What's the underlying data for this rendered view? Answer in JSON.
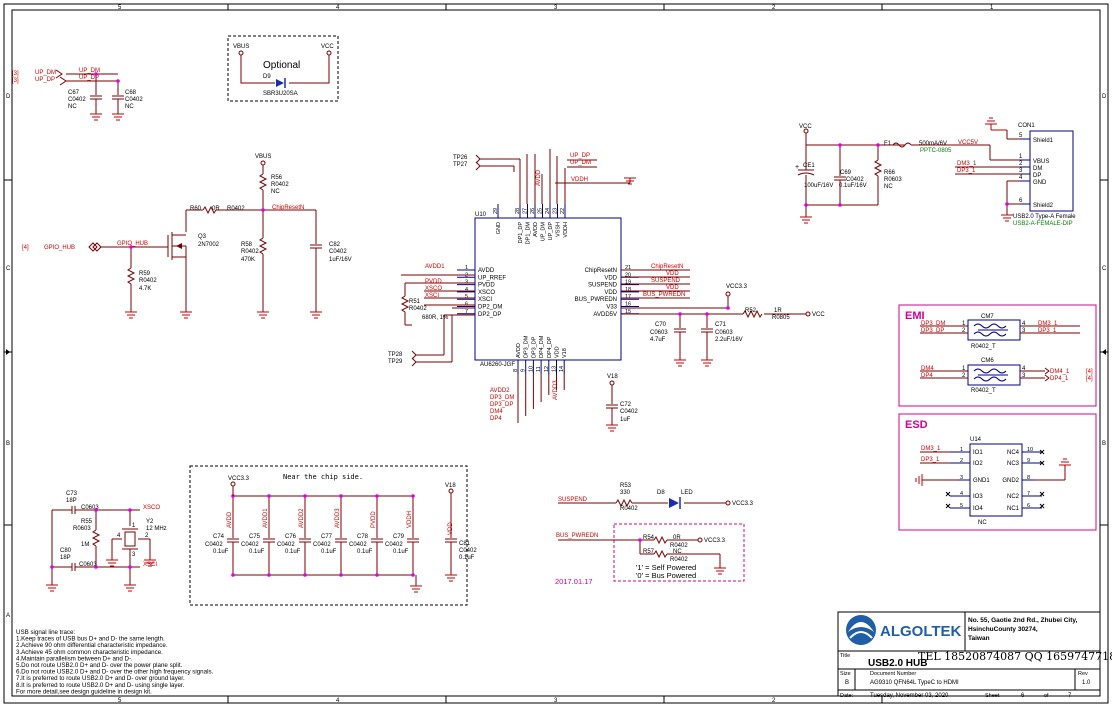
{
  "frame": {
    "cols": [
      "5",
      "4",
      "3",
      "2",
      "1"
    ],
    "rows": [
      "D",
      "C",
      "B",
      "A"
    ]
  },
  "notes": {
    "optional": "Optional",
    "near_chip": "Near the chip side.",
    "date": "2017.01.17",
    "self_powered": "'1' = Self Powered",
    "bus_powered": "'0' = Bus Powered",
    "usb_trace": [
      "USB signal line trace:",
      "1.Keep traces of USB bus D+ and D- the same length.",
      "2.Achieve 90 ohm differential characteristic impedance.",
      "3.Achieve 45 ohm common characteristic impedance.",
      "4.Maintain parallelism between D+ and D-.",
      "5.Do not route USB2.0 D+ and D- over the power plane split.",
      "6.Do not route USB2.0 D+ and D- over the other  high frequency signals.",
      "7.It is preferred to route USB2.0 D+ and D- over ground layer.",
      "8.It is preferred to route USB2.0 D+ and D- using single layer.",
      "For more detail,see design guideline in design kit."
    ]
  },
  "nets": {
    "up_dm": "UP_DM",
    "up_dp": "UP_DP",
    "vbus": "VBUS",
    "vcc": "VCC",
    "vcc33": "VCC3.3",
    "vcc5v": "VCC5V",
    "vddh": "VDDH",
    "chipreset": "ChipResetN",
    "gpio_hub": "GPIO_HUB",
    "avdd1": "AVDD1",
    "avdd2": "AVDD2",
    "avdd3": "AVDD3",
    "pvdd": "PVDD",
    "xsco": "XSCO",
    "xsci": "XSCI",
    "avdd": "AVDD",
    "vdd": "VDD",
    "suspend": "SUSPEND",
    "bus_pwredn": "BUS_PWREDN",
    "v18": "V18",
    "dm3": "DM3",
    "dp3": "DP3",
    "dm4": "DM4",
    "dp4": "DP4",
    "dp3_dm": "DP3_DM",
    "dp3_dp": "DP3_DP",
    "dm3_1": "DM3_1",
    "dp3_1": "DP3_1",
    "dm4_1": "DM4_1",
    "dp4_1": "DP4_1",
    "ref3": "[3]",
    "ref4": "[4]"
  },
  "parts": {
    "c67": {
      "ref": "C67",
      "pkg": "C0402",
      "val": "NC"
    },
    "c68": {
      "ref": "C68",
      "pkg": "C0402",
      "val": "NC"
    },
    "d9": {
      "ref": "D9",
      "val": "SBR3U20SA"
    },
    "r56": {
      "ref": "R56",
      "pkg": "R0402",
      "val": "NC"
    },
    "r60": {
      "ref": "R60",
      "val": "0R",
      "pkg": "R0402"
    },
    "q3": {
      "ref": "Q3",
      "val": "2N7002"
    },
    "r58": {
      "ref": "R58",
      "pkg": "R0402",
      "val": "470K"
    },
    "c82": {
      "ref": "C82",
      "pkg": "C0402",
      "val": "1uF/16V"
    },
    "r59": {
      "ref": "R59",
      "pkg": "R0402",
      "val": "4.7K"
    },
    "tp26": "TP26",
    "tp27": "TP27",
    "tp28": "TP28",
    "tp29": "TP29",
    "u10": {
      "ref": "U10",
      "val": "AU6260-JGF"
    },
    "r51": {
      "ref": "R51",
      "pkg": "R0402",
      "val": "680R, 1%"
    },
    "c70": {
      "ref": "C70",
      "pkg": "C0603",
      "val": "4.7uF"
    },
    "c71": {
      "ref": "C71",
      "pkg": "C0603",
      "val": "2.2uF/16V"
    },
    "r52": {
      "ref": "R52",
      "val": "1R",
      "pkg": "R0805"
    },
    "c72": {
      "ref": "C72",
      "pkg": "C0402",
      "val": "1uF"
    },
    "ce1": {
      "ref": "CE1",
      "val": "100uF/16V"
    },
    "c69": {
      "ref": "C69",
      "pkg": "C0402",
      "val": "0.1uF/16V"
    },
    "r66": {
      "ref": "R66",
      "pkg": "R0603",
      "val": "NC"
    },
    "f1": {
      "ref": "F1",
      "val": "500mA/6V",
      "pkg": "PPTC-0805"
    },
    "con1": {
      "ref": "CON1",
      "val": "USB2.0 Type-A Female",
      "pkg": "USB2-A-FEMALE-DIP"
    },
    "cm7": {
      "ref": "CM7",
      "pkg": "R0402_T"
    },
    "cm6": {
      "ref": "CM6",
      "pkg": "R0402_T"
    },
    "u14": {
      "ref": "U14",
      "val": "NC"
    },
    "c73": {
      "ref": "C73",
      "val": "18P",
      "pkg": "C0603"
    },
    "c80": {
      "ref": "C80",
      "val": "18P",
      "pkg": "C0603"
    },
    "r55": {
      "ref": "R55",
      "pkg": "R0603",
      "val": "1M"
    },
    "y2": {
      "ref": "Y2",
      "val": "12 MHz"
    },
    "r53": {
      "ref": "R53",
      "val": "330",
      "pkg": "R0402"
    },
    "d8": {
      "ref": "D8",
      "val": "LED"
    },
    "r54": {
      "ref": "R54",
      "val": "0R",
      "pkg": "R0402"
    },
    "r57": {
      "ref": "R57",
      "val": "NC",
      "pkg": "R0402"
    },
    "decap": [
      {
        "ref": "C74",
        "pkg": "C0402",
        "val": "0.1uF",
        "net": "AVDD"
      },
      {
        "ref": "C75",
        "pkg": "C0402",
        "val": "0.1uF",
        "net": "AVDD1"
      },
      {
        "ref": "C76",
        "pkg": "C0402",
        "val": "0.1uF",
        "net": "AVDD2"
      },
      {
        "ref": "C77",
        "pkg": "C0402",
        "val": "0.1uF",
        "net": "AVDD3"
      },
      {
        "ref": "C78",
        "pkg": "C0402",
        "val": "0.1uF",
        "net": "PVDD"
      },
      {
        "ref": "C79",
        "pkg": "C0402",
        "val": "0.1uF",
        "net": "VDDH"
      }
    ],
    "c81": {
      "ref": "C81",
      "pkg": "C0402",
      "val": "0.1uF",
      "net": "VDD"
    }
  },
  "u10_pins": {
    "left": [
      {
        "num": "1",
        "name": "AVDD"
      },
      {
        "num": "2",
        "name": "UP_RREF"
      },
      {
        "num": "3",
        "name": "PVDD"
      },
      {
        "num": "4",
        "name": "XSCO"
      },
      {
        "num": "5",
        "name": "XSCI"
      },
      {
        "num": "6",
        "name": "DP2_DM"
      },
      {
        "num": "7",
        "name": "DP2_DP"
      }
    ],
    "right": [
      {
        "num": "21",
        "name": "ChipResetN"
      },
      {
        "num": "20",
        "name": "VDD"
      },
      {
        "num": "19",
        "name": "SUSPEND"
      },
      {
        "num": "18",
        "name": "VDD"
      },
      {
        "num": "17",
        "name": "BUS_PWREDN"
      },
      {
        "num": "16",
        "name": "V33"
      },
      {
        "num": "15",
        "name": "AVDD5V"
      }
    ],
    "top": [
      {
        "num": "29",
        "name": "GND"
      },
      {
        "num": "28",
        "name": "DP1_DP"
      },
      {
        "num": "27",
        "name": "DP1_DM"
      },
      {
        "num": "26",
        "name": "AVDD"
      },
      {
        "num": "25",
        "name": "UP_DM"
      },
      {
        "num": "24",
        "name": "UP_DP"
      },
      {
        "num": "23",
        "name": "VSSH"
      },
      {
        "num": "22",
        "name": "VDDH"
      }
    ],
    "bottom": [
      {
        "num": "8",
        "name": "AVDD"
      },
      {
        "num": "9",
        "name": "DP3_DM"
      },
      {
        "num": "10",
        "name": "DP3_DP"
      },
      {
        "num": "11",
        "name": "DP4_DM"
      },
      {
        "num": "12",
        "name": "DP4_DP"
      },
      {
        "num": "13",
        "name": "VDD"
      },
      {
        "num": "14",
        "name": "V18"
      }
    ]
  },
  "con1_pins": [
    {
      "num": "5",
      "name": "Shield1"
    },
    {
      "num": "1",
      "name": "VBUS"
    },
    {
      "num": "2",
      "name": "DM"
    },
    {
      "num": "3",
      "name": "DP"
    },
    {
      "num": "4",
      "name": "GND"
    },
    {
      "num": "6",
      "name": "Shield2"
    }
  ],
  "u14_pins": {
    "left": [
      {
        "num": "1",
        "name": "IO1"
      },
      {
        "num": "2",
        "name": "IO2"
      },
      {
        "num": "3",
        "name": "GND1"
      },
      {
        "num": "4",
        "name": "IO3"
      },
      {
        "num": "5",
        "name": "IO4"
      }
    ],
    "right": [
      {
        "num": "10",
        "name": "NC4"
      },
      {
        "num": "9",
        "name": "NC3"
      },
      {
        "num": "8",
        "name": "GND2"
      },
      {
        "num": "7",
        "name": "NC2"
      },
      {
        "num": "6",
        "name": "NC1"
      }
    ]
  },
  "boxes": {
    "emi": "EMI",
    "esd": "ESD"
  },
  "title_block": {
    "company": "ALGOLTEK",
    "address": [
      "No. 55, Gaotie 2nd Rd., Zhubei City,",
      "HsinchuCounty 30274,",
      "Taiwan"
    ],
    "phone": "TEL 18520874087 QQ 1659747718",
    "title_label": "Title",
    "title": "USB2.0 HUB",
    "size_label": "Size",
    "size": "B",
    "docnum_label": "Document Number",
    "docnum": "AG9310 QFN64L TypeC to HDMI",
    "rev_label": "Rev",
    "rev": "1.0",
    "date_label": "Date:",
    "date": "Tuesday, November 03, 2020",
    "sheet_label": "Sheet",
    "sheet": "6",
    "of_label": "of",
    "sheets": "7"
  },
  "colors": {
    "wire": "#7a0000",
    "net": "#cc0000",
    "pin": "#000080",
    "part": "#000000",
    "junction": "#e000e0",
    "ground": "#c00000",
    "emi": "#d10096",
    "green": "#008000",
    "pwr": "#7a0000"
  }
}
